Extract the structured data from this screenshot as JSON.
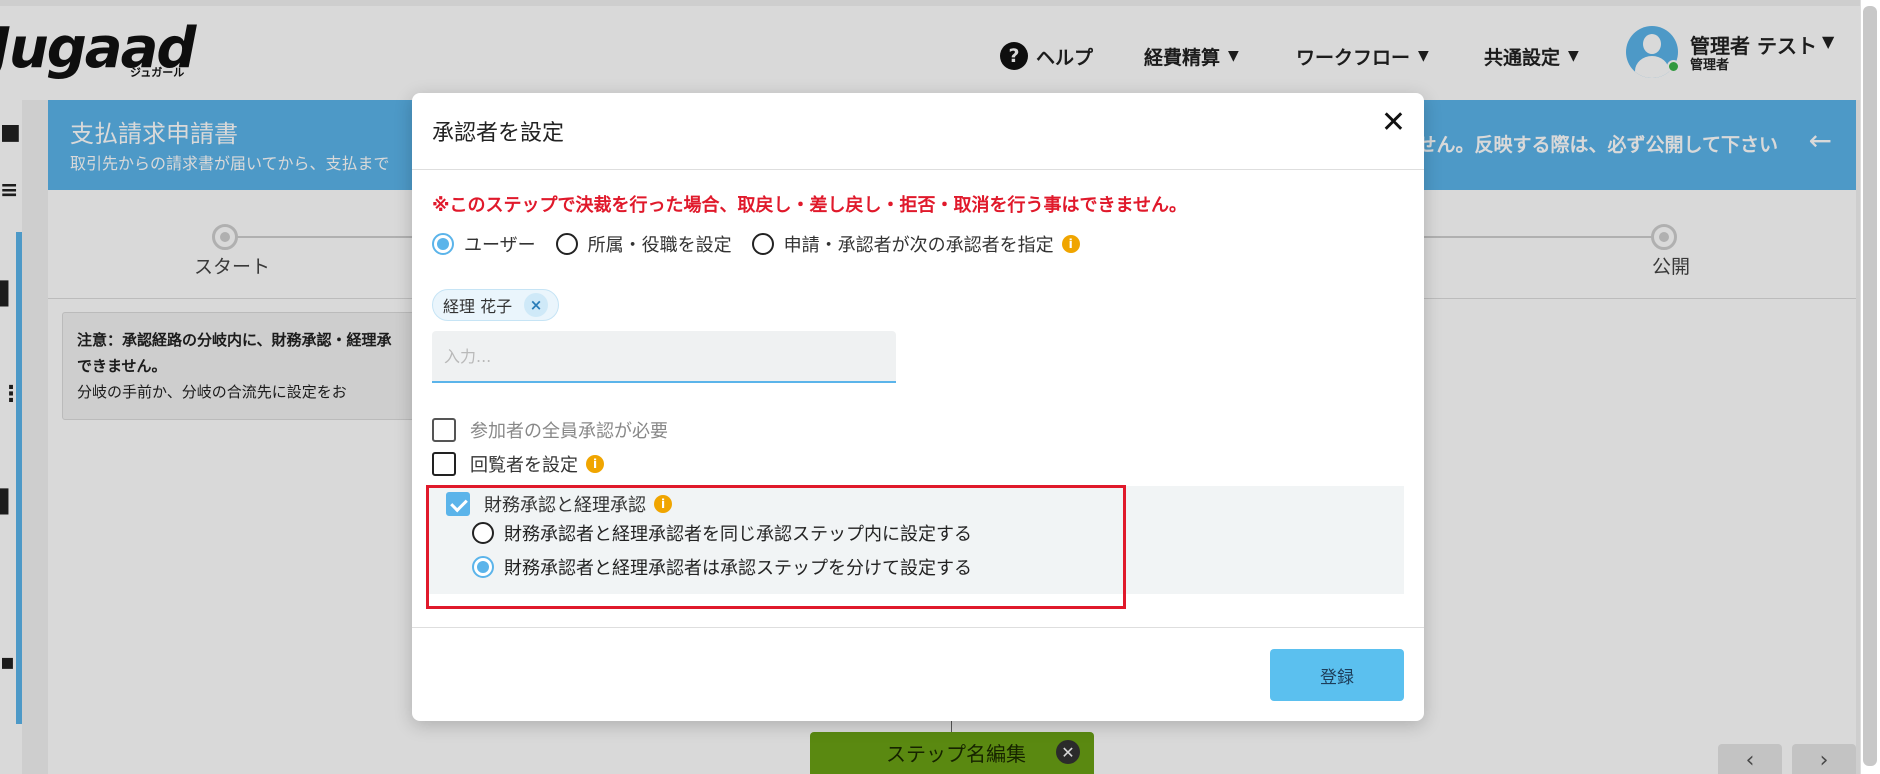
{
  "header": {
    "logo": "Jugaad",
    "logo_sub": "ジュガール",
    "help": "ヘルプ",
    "menu_expense": "経費精算",
    "menu_workflow": "ワークフロー",
    "menu_common": "共通設定",
    "user_name": "管理者 テスト",
    "user_role": "管理者"
  },
  "page": {
    "title": "支払請求申請書",
    "subtitle": "取引先からの請求書が届いてから、支払まで",
    "banner_right": "ません。反映する際は、必ず公開して下さい",
    "steps": [
      "スタート",
      "公開"
    ],
    "notice_bold_1": "注意：承認経路の分岐内に、財務承認・経理承",
    "notice_bold_2": "できません。",
    "notice_text": "分岐の手前か、分岐の合流先に設定をお",
    "step_card_title": "ステップ名編集"
  },
  "modal": {
    "title": "承認者を設定",
    "warning": "※このステップで決裁を行った場合、取戻し・差し戻し・拒否・取消を行う事はできません。",
    "type_options": [
      {
        "label": "ユーザー",
        "selected": true
      },
      {
        "label": "所属・役職を設定",
        "selected": false
      },
      {
        "label": "申請・承認者が次の承認者を指定",
        "selected": false
      }
    ],
    "selected_user_tag": "経理 花子",
    "input_placeholder": "入力...",
    "all_approval_label": "参加者の全員承認が必要",
    "viewer_label": "回覧者を設定",
    "finance_label": "財務承認と経理承認",
    "finance_options": [
      {
        "label": "財務承認者と経理承認者を同じ承認ステップ内に設定する",
        "selected": false
      },
      {
        "label": "財務承認者と経理承認者は承認ステップを分けて設定する",
        "selected": true
      }
    ],
    "submit_label": "登録"
  },
  "colors": {
    "accent": "#5bb4ea",
    "warning": "#e0192b",
    "info": "#f0a500",
    "step_card": "#6aa214"
  },
  "icons": [
    "help-icon",
    "caret-down-icon",
    "close-icon",
    "info-icon",
    "tag-remove-icon",
    "check-icon",
    "back-arrow-icon"
  ]
}
